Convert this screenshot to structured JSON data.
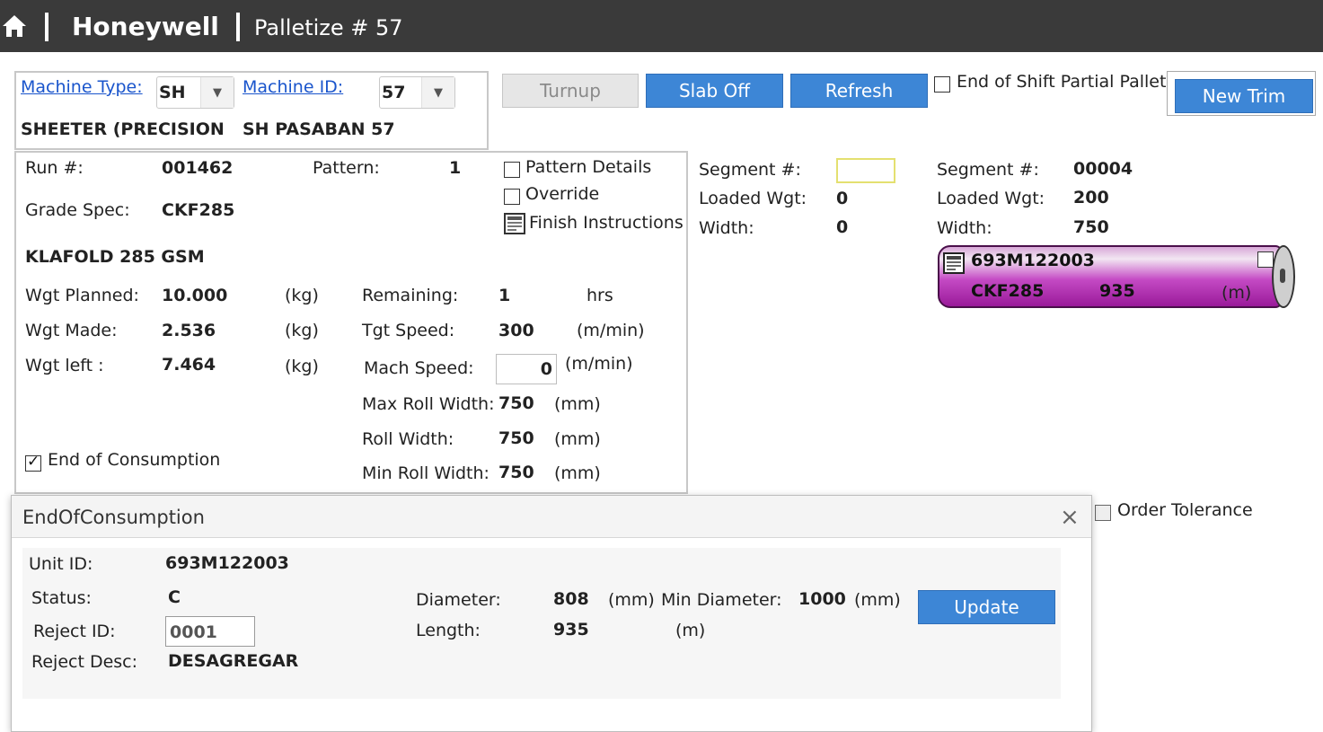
{
  "header": {
    "app": "Honeywell",
    "screen": "Palletize # 57",
    "home_icon": "home-icon"
  },
  "machine": {
    "type_label": "Machine Type:",
    "type_value": "SH",
    "id_label": "Machine ID:",
    "id_value": "57",
    "type_desc": "SHEETER (PRECISION",
    "id_desc": "SH PASABAN 57"
  },
  "toolbar": {
    "turnup": "Turnup",
    "slab_off": "Slab Off",
    "refresh": "Refresh",
    "end_shift": "End of Shift Partial Pallet",
    "new_trim": "New Trim"
  },
  "run": {
    "run_label": "Run #:",
    "run_value": "001462",
    "pattern_label": "Pattern:",
    "pattern_value": "1",
    "pattern_details": "Pattern Details",
    "override": "Override",
    "finish": "Finish Instructions",
    "grade_label": "Grade Spec:",
    "grade_value": "CKF285",
    "grade_desc": "KLAFOLD 285 GSM",
    "wgt_planned_label": "Wgt Planned:",
    "wgt_planned": "10.000",
    "wgt_planned_unit": "(kg)",
    "wgt_made_label": "Wgt Made:",
    "wgt_made": "2.536",
    "wgt_made_unit": "(kg)",
    "wgt_left_label": "Wgt left :",
    "wgt_left": "7.464",
    "wgt_left_unit": "(kg)",
    "remaining_label": "Remaining:",
    "remaining": "1",
    "remaining_unit": "hrs",
    "tgt_speed_label": "Tgt Speed:",
    "tgt_speed": "300",
    "tgt_speed_unit": "(m/min)",
    "mach_speed_label": "Mach Speed:",
    "mach_speed": "0",
    "mach_speed_unit": "(m/min)",
    "max_roll_label": "Max Roll Width:",
    "max_roll": "750",
    "max_roll_unit": "(mm)",
    "roll_width_label": "Roll Width:",
    "roll_width": "750",
    "roll_width_unit": "(mm)",
    "min_roll_label": "Min Roll Width:",
    "min_roll": "750",
    "min_roll_unit": "(mm)",
    "end_consumption": "End of Consumption"
  },
  "segment_left": {
    "segment_label": "Segment #:",
    "segment_value": "",
    "loaded_label": "Loaded Wgt:",
    "loaded_value": "0",
    "width_label": "Width:",
    "width_value": "0"
  },
  "segment_right": {
    "segment_label": "Segment #:",
    "segment_value": "00004",
    "loaded_label": "Loaded Wgt:",
    "loaded_value": "200",
    "width_label": "Width:",
    "width_value": "750"
  },
  "roll": {
    "unit_id": "693M122003",
    "grade": "CKF285",
    "length": "935",
    "unit": "(m)"
  },
  "order_tolerance": "Order Tolerance",
  "modal": {
    "title": "EndOfConsumption",
    "close": "×",
    "unit_id_label": "Unit ID:",
    "unit_id": "693M122003",
    "status_label": "Status:",
    "status": "C",
    "reject_id_label": "Reject ID:",
    "reject_id": "0001",
    "reject_desc_label": "Reject Desc:",
    "reject_desc": "DESAGREGAR",
    "diameter_label": "Diameter:",
    "diameter": "808",
    "diameter_unit": "(mm)",
    "min_diameter_label": "Min Diameter:",
    "min_diameter": "1000",
    "min_diameter_unit": "(mm)",
    "length_label": "Length:",
    "length": "935",
    "length_unit": "(m)",
    "update": "Update"
  }
}
